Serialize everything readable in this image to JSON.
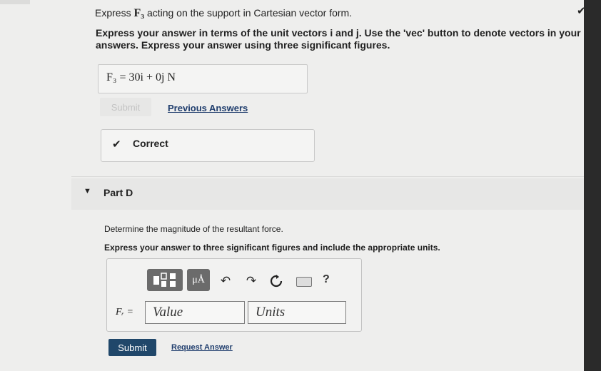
{
  "partC": {
    "question_prefix": "Express",
    "question_symbol": "F₃",
    "question_suffix": "acting on the support in Cartesian vector form.",
    "instruction": "Express your answer in terms of the unit vectors i and j. Use the 'vec' button to denote vectors in your answers. Express your answer using three significant figures.",
    "answer": "F₃ =  30i + 0j  N",
    "submit_label": "Submit",
    "previous_answers_label": "Previous Answers",
    "correct_label": "Correct"
  },
  "partD": {
    "title": "Part D",
    "question": "Determine the magnitude of the resultant force.",
    "instruction": "Express your answer to three significant figures and include the appropriate units.",
    "toolbar": {
      "mu_label": "μÅ",
      "help_label": "?"
    },
    "variable_label": "Fᵣ =",
    "value_placeholder": "Value",
    "units_placeholder": "Units",
    "submit_label": "Submit",
    "request_answer_label": "Request Answer"
  },
  "colors": {
    "submit_bg": "#20476a",
    "link": "#1f3d6d"
  }
}
